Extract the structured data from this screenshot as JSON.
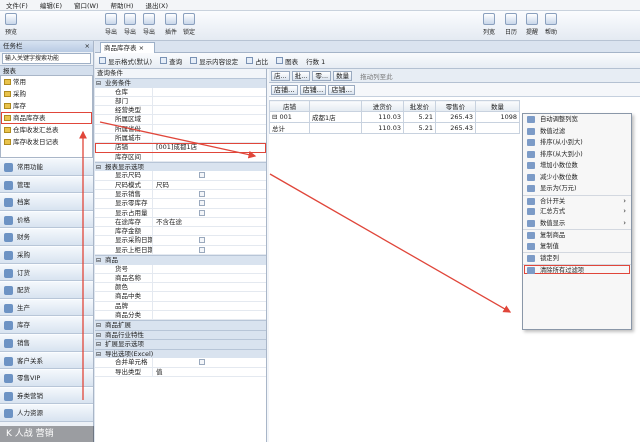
{
  "menu": [
    "文件(F)",
    "编辑(E)",
    "窗口(W)",
    "帮助(H)",
    "退出(X)"
  ],
  "toolbar": [
    "预览",
    "导出",
    "导出",
    "导出",
    "插件",
    "锁定",
    "列宽",
    "日历",
    "提醒",
    "帮助"
  ],
  "sidebar": {
    "title": "任务栏",
    "search_placeholder": "输入关键字搜索功能",
    "report_header": "报表",
    "tree": [
      "常用",
      "采购",
      "库存",
      "商品库存表",
      "仓库收发汇总表",
      "库存收发日记表"
    ],
    "modules": [
      "常用功能",
      "管理",
      "档案",
      "价格",
      "财务",
      "采购",
      "订货",
      "配货",
      "生产",
      "库存",
      "销售",
      "客户关系",
      "零售VIP",
      "券类营销",
      "人力资源"
    ]
  },
  "main": {
    "tab": "商品库存表",
    "subtoolbar": [
      "显示格式(默认)",
      "查询",
      "显示内容设定",
      "占比",
      "图表",
      "行数 1"
    ],
    "cond_title": "查询条件",
    "sections": [
      {
        "title": "业务条件",
        "rows": [
          [
            "仓库",
            ""
          ],
          [
            "部门",
            ""
          ],
          [
            "经营类型",
            ""
          ],
          [
            "所属区域",
            ""
          ],
          [
            "所属省份",
            ""
          ],
          [
            "所属城市",
            ""
          ],
          [
            "店铺",
            "[001]成都1店"
          ],
          [
            "库存区间",
            ""
          ]
        ]
      },
      {
        "title": "报表显示选项",
        "rows": [
          [
            "显示尺码",
            "cb"
          ],
          [
            "尺码模式",
            "尺码"
          ],
          [
            "显示销售",
            "cb"
          ],
          [
            "显示零库存",
            "cb"
          ],
          [
            "显示占用量",
            "cb"
          ],
          [
            "在途库存",
            "不含在途"
          ],
          [
            "库存金额",
            ""
          ],
          [
            "显示采购日期",
            "cb"
          ],
          [
            "显示上柜日期",
            "cb"
          ]
        ]
      },
      {
        "title": "商品",
        "rows": [
          [
            "货号",
            ""
          ],
          [
            "商品名称",
            ""
          ],
          [
            "颜色",
            ""
          ],
          [
            "商品中类",
            ""
          ],
          [
            "品牌",
            ""
          ],
          [
            "商品分类",
            ""
          ]
        ]
      },
      {
        "title": "商品扩展",
        "rows": []
      },
      {
        "title": "商品行业特性",
        "rows": []
      },
      {
        "title": "扩展显示选项",
        "rows": []
      },
      {
        "title": "导出选项(Excel)",
        "rows": [
          [
            "合并单元格",
            "cb"
          ],
          [
            "导出类型",
            "值"
          ]
        ]
      }
    ],
    "grid": {
      "btns": [
        "店...",
        "批...",
        "零...",
        "数量"
      ],
      "hint": "拖动列至此",
      "groups": [
        "店铺...",
        "店铺...",
        "店铺..."
      ],
      "headers": [
        "店铺",
        "",
        "进货价",
        "批发价",
        "零售价",
        "数量"
      ],
      "rows": [
        [
          "⊟ 001",
          "成都1店",
          "110.03",
          "5.21",
          "265.43",
          "1098"
        ],
        [
          "总计",
          "",
          "110.03",
          "5.21",
          "265.43",
          ""
        ]
      ]
    }
  },
  "context_menu": [
    "自动调整列宽",
    "数值过滤",
    "排序(从小到大)",
    "排序(从大到小)",
    "增加小数位数",
    "减少小数位数",
    "显示为(万元)",
    "合计开关",
    "汇总方式",
    "数值显示",
    "复制商品",
    "复制值",
    "锁定列",
    "清除所有过滤项"
  ],
  "watermark": "K 人战 营销"
}
